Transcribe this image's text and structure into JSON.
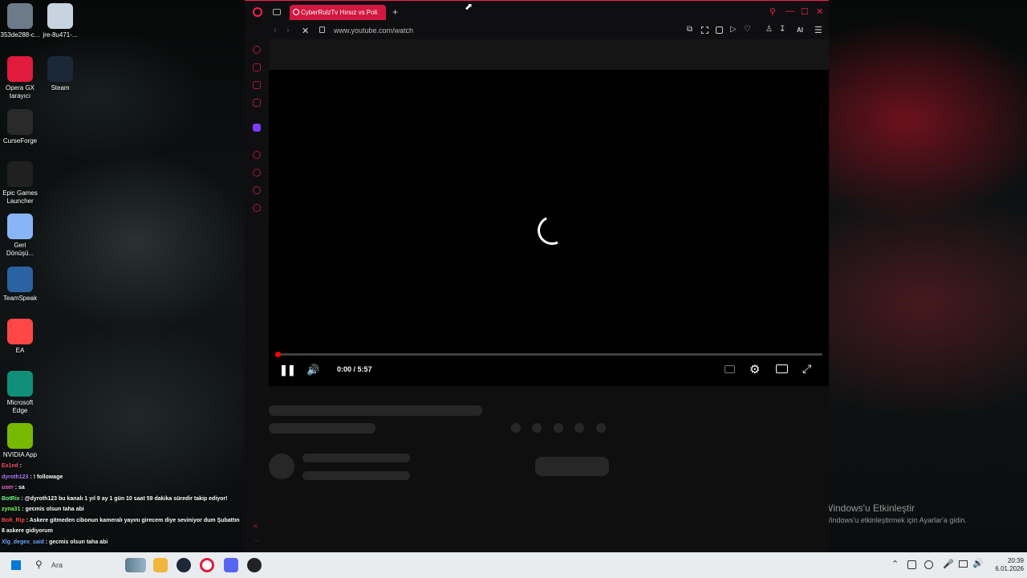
{
  "desktop": {
    "icons": [
      {
        "label": "353de288-c...",
        "color": "#6c7a89"
      },
      {
        "label": "jre-8u471-...",
        "color": "#c8d3e0"
      },
      {
        "label": "Opera GX tarayıcı",
        "color": "#e01b3c"
      },
      {
        "label": "Steam",
        "color": "#1b2838"
      },
      {
        "label": "CurseForge",
        "color": "#2a2a2a"
      },
      {
        "label": "Epic Games Launcher",
        "color": "#202020"
      },
      {
        "label": "Geri Dönüşü...",
        "color": "#8ab4f8"
      },
      {
        "label": "TeamSpeak",
        "color": "#2b62a3"
      },
      {
        "label": "EA",
        "color": "#ff4747"
      },
      {
        "label": "Microsoft Edge",
        "color": "#0f8f7a"
      },
      {
        "label": "NVIDIA App",
        "color": "#76b900"
      }
    ]
  },
  "browser": {
    "tab_title": "CyberRulzTv Hırsız vs Poli",
    "url": "www.youtube.com/watch",
    "new_tab_symbol": "+",
    "ai_label": "AI",
    "accent": "#fa1e4e"
  },
  "player": {
    "time": "0:00 / 5:57",
    "progress": 0.0
  },
  "chat": {
    "lines": [
      {
        "user": "Ex1ed",
        "msg": " : ",
        "color": "#ff4d6d"
      },
      {
        "user": "dyroth123",
        "msg": " : ! followage",
        "color": "#b57bff"
      },
      {
        "user": "user",
        "msg": " : sa",
        "color": "#ff6bd6"
      },
      {
        "user": "BotRix",
        "msg": " : @dyroth123 bu kanalı 1 yıl 9 ay 1 gün 10 saat 59 dakika süredir takip ediyor!",
        "color": "#6bff8c"
      },
      {
        "user": "zyna31",
        "msg": " : gecmis olsun taha abi",
        "color": "#7bff57"
      },
      {
        "user": "Bolt_Rip",
        "msg": " : Askere gitmeden cibonun kameralı yayını girecem diye seviniyor dum Şubattın 8 askere gidiyorum",
        "color": "#ff4d4d"
      },
      {
        "user": "Xlg_degex_said",
        "msg": " : gecmis olsun taha abi",
        "color": "#6fa8ff"
      }
    ]
  },
  "activation": {
    "title": "Windows'u Etkinleştir",
    "subtitle": "Windows'u etkinleştirmek için Ayarlar'a gidin."
  },
  "taskbar": {
    "search_label": "Ara",
    "time": "20:39",
    "date": "6.01.2026"
  }
}
